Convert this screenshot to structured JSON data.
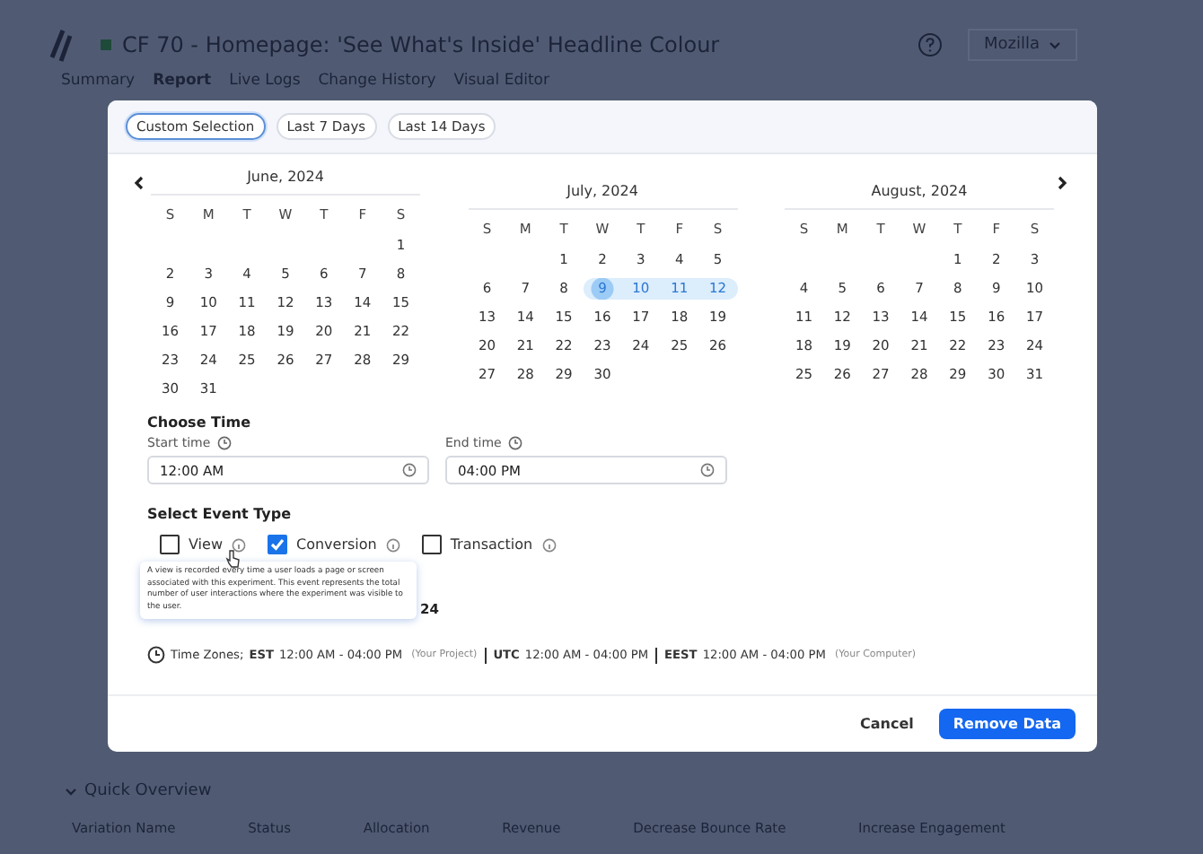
{
  "page": {
    "title": "CF 70 - Homepage: 'See What's Inside' Headline Colour",
    "tabs": [
      {
        "label": "Summary",
        "selected": false
      },
      {
        "label": "Report",
        "selected": true
      },
      {
        "label": "Live Logs",
        "selected": false
      },
      {
        "label": "Change History",
        "selected": false
      },
      {
        "label": "Visual Editor",
        "selected": false
      }
    ],
    "account": "Mozilla",
    "section": "Quick Overview",
    "columns": [
      "Variation Name",
      "Status",
      "Allocation",
      "Revenue",
      "Decrease Bounce Rate",
      "Increase Engagement"
    ]
  },
  "modal": {
    "presets": [
      {
        "label": "Custom Selection",
        "selected": true
      },
      {
        "label": "Last 7 Days",
        "selected": false
      },
      {
        "label": "Last 14 Days",
        "selected": false
      }
    ],
    "months": [
      {
        "title": "June, 2024",
        "weekdays": [
          "S",
          "M",
          "T",
          "W",
          "T",
          "F",
          "S"
        ],
        "weeks": [
          [
            {
              "d": "1",
              "selected": false
            }
          ],
          [
            {
              "d": "2",
              "selected": false
            },
            {
              "d": "3",
              "selected": false
            },
            {
              "d": "4",
              "selected": false
            },
            {
              "d": "5",
              "selected": false
            },
            {
              "d": "6",
              "selected": false
            },
            {
              "d": "7",
              "selected": false
            },
            {
              "d": "8",
              "selected": false
            }
          ],
          [
            {
              "d": "9",
              "selected": false
            },
            {
              "d": "10",
              "selected": false
            },
            {
              "d": "11",
              "selected": false
            },
            {
              "d": "12",
              "selected": false
            },
            {
              "d": "13",
              "selected": false
            },
            {
              "d": "14",
              "selected": false
            },
            {
              "d": "15",
              "selected": false
            }
          ],
          [
            {
              "d": "16",
              "selected": false
            },
            {
              "d": "17",
              "selected": false
            },
            {
              "d": "18",
              "selected": false
            },
            {
              "d": "19",
              "selected": false
            },
            {
              "d": "20",
              "selected": false
            },
            {
              "d": "21",
              "selected": false
            },
            {
              "d": "22",
              "selected": false
            }
          ],
          [
            {
              "d": "23",
              "selected": false
            },
            {
              "d": "24",
              "selected": false
            },
            {
              "d": "25",
              "selected": false
            },
            {
              "d": "26",
              "selected": false
            },
            {
              "d": "27",
              "selected": false
            },
            {
              "d": "28",
              "selected": false
            },
            {
              "d": "29",
              "selected": false
            }
          ],
          [
            {
              "d": "30",
              "selected": false
            },
            {
              "d": "31",
              "selected": false
            }
          ]
        ]
      },
      {
        "title": "July, 2024",
        "weekdays": [
          "S",
          "M",
          "T",
          "W",
          "T",
          "F",
          "S"
        ],
        "weeks": [
          [
            {
              "d": "1",
              "selected": false
            },
            {
              "d": "2",
              "selected": false
            },
            {
              "d": "3",
              "selected": false
            },
            {
              "d": "4",
              "selected": false
            },
            {
              "d": "5",
              "selected": false
            }
          ],
          [
            {
              "d": "6",
              "selected": false
            },
            {
              "d": "7",
              "selected": false
            },
            {
              "d": "8",
              "selected": false
            },
            {
              "d": "9",
              "selected": true
            },
            {
              "d": "10",
              "selected": true
            },
            {
              "d": "11",
              "selected": true
            },
            {
              "d": "12",
              "selected": true
            }
          ],
          [
            {
              "d": "13",
              "selected": false
            },
            {
              "d": "14",
              "selected": false
            },
            {
              "d": "15",
              "selected": false
            },
            {
              "d": "16",
              "selected": false
            },
            {
              "d": "17",
              "selected": false
            },
            {
              "d": "18",
              "selected": false
            },
            {
              "d": "19",
              "selected": false
            }
          ],
          [
            {
              "d": "20",
              "selected": false
            },
            {
              "d": "21",
              "selected": false
            },
            {
              "d": "22",
              "selected": false
            },
            {
              "d": "23",
              "selected": false
            },
            {
              "d": "24",
              "selected": false
            },
            {
              "d": "25",
              "selected": false
            },
            {
              "d": "26",
              "selected": false
            }
          ],
          [
            {
              "d": "27",
              "selected": false
            },
            {
              "d": "28",
              "selected": false
            },
            {
              "d": "29",
              "selected": false
            },
            {
              "d": "30",
              "selected": false
            }
          ]
        ]
      },
      {
        "title": "August, 2024",
        "weekdays": [
          "S",
          "M",
          "T",
          "W",
          "T",
          "F",
          "S"
        ],
        "weeks": [
          [
            {
              "d": "1",
              "selected": false
            },
            {
              "d": "2",
              "selected": false
            },
            {
              "d": "3",
              "selected": false
            }
          ],
          [
            {
              "d": "4",
              "selected": false
            },
            {
              "d": "5",
              "selected": false
            },
            {
              "d": "6",
              "selected": false
            },
            {
              "d": "7",
              "selected": false
            },
            {
              "d": "8",
              "selected": false
            },
            {
              "d": "9",
              "selected": false
            },
            {
              "d": "10",
              "selected": false
            }
          ],
          [
            {
              "d": "11",
              "selected": false
            },
            {
              "d": "12",
              "selected": false
            },
            {
              "d": "13",
              "selected": false
            },
            {
              "d": "14",
              "selected": false
            },
            {
              "d": "15",
              "selected": false
            },
            {
              "d": "16",
              "selected": false
            },
            {
              "d": "17",
              "selected": false
            }
          ],
          [
            {
              "d": "18",
              "selected": false
            },
            {
              "d": "19",
              "selected": false
            },
            {
              "d": "20",
              "selected": false
            },
            {
              "d": "21",
              "selected": false
            },
            {
              "d": "22",
              "selected": false
            },
            {
              "d": "23",
              "selected": false
            },
            {
              "d": "24",
              "selected": false
            }
          ],
          [
            {
              "d": "25",
              "selected": false
            },
            {
              "d": "26",
              "selected": false
            },
            {
              "d": "27",
              "selected": false
            },
            {
              "d": "28",
              "selected": false
            },
            {
              "d": "29",
              "selected": false
            },
            {
              "d": "30",
              "selected": false
            },
            {
              "d": "31",
              "selected": false
            }
          ]
        ]
      }
    ],
    "time_heading": "Choose Time",
    "start_label": "Start time",
    "start_value": "12:00 AM",
    "end_label": "End time",
    "end_value": "04:00 PM",
    "event_heading": "Select Event Type",
    "events": [
      {
        "label": "View",
        "checked": false
      },
      {
        "label": "Conversion",
        "checked": true
      },
      {
        "label": "Transaction",
        "checked": false
      }
    ],
    "tooltip": "A view is recorded every time a user loads a page or screen associated with this experiment. This event represents the total number of user interactions where the experiment was visible to the user.",
    "range_tail": "24",
    "tz_label": "Time Zones;",
    "zones": [
      {
        "code": "EST",
        "range": "12:00 AM - 04:00 PM",
        "note": "(Your Project)"
      },
      {
        "code": "UTC",
        "range": "12:00 AM - 04:00 PM"
      },
      {
        "code": "EEST",
        "range": "12:00 AM - 04:00 PM",
        "note": "(Your Computer)"
      }
    ],
    "cancel": "Cancel",
    "confirm": "Remove Data"
  }
}
